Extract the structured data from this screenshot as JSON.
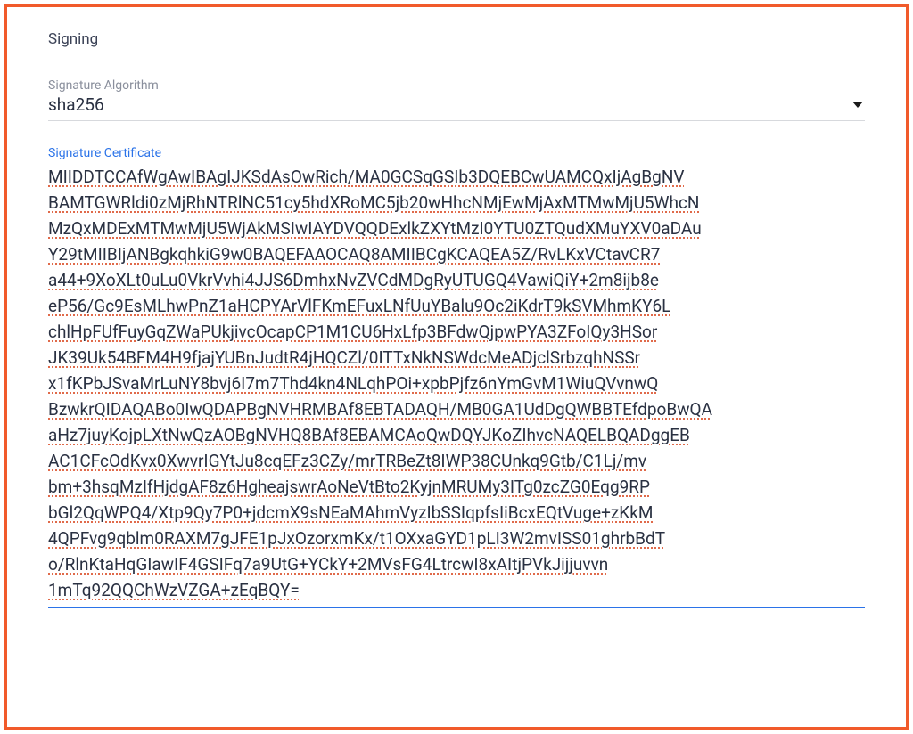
{
  "section": {
    "title": "Signing"
  },
  "signatureAlgorithm": {
    "label": "Signature Algorithm",
    "value": "sha256"
  },
  "signatureCertificate": {
    "label": "Signature Certificate",
    "value": "MIIDDTCCAfWgAwIBAgIJKSdAsOwRich/MA0GCSqGSIb3DQEBCwUAMCQxIjAgBgNV\nBAMTGWRldi0zMjRhNTRlNC51cy5hdXRoMC5jb20wHhcNMjEwMjAxMTMwMjU5WhcN\nMzQxMDExMTMwMjU5WjAkMSIwIAYDVQQDExlkZXYtMzI0YTU0ZTQudXMuYXV0aDAu\nY29tMIIBIjANBgkqhkiG9w0BAQEFAAOCAQ8AMIIBCgKCAQEA5Z/RvLKxVCtavCR7\na44+9XoXLt0uLu0VkrVvhi4JJS6DmhxNvZVCdMDgRyUTUGQ4VawiQiY+2m8ijb8e\neP56/Gc9EsMLhwPnZ1aHCPYArVlFKmEFuxLNfUuYBalu9Oc2iKdrT9kSVMhmKY6L\nchlHpFUfFuyGqZWaPUkjivcOcapCP1M1CU6HxLfp3BFdwQjpwPYA3ZFoIQy3HSor\nJK39Uk54BFM4H9fjajYUBnJudtR4jHQCZl/0ITTxNkNSWdcMeADjclSrbzqhNSSr\nx1fKPbJSvaMrLuNY8bvj6I7m7Thd4kn4NLqhPOi+xpbPjfz6nYmGvM1WiuQVvnwQ\nBzwkrQIDAQABo0IwQDAPBgNVHRMBAf8EBTADAQH/MB0GA1UdDgQWBBTEfdpoBwQA\naHz7juyKojpLXtNwQzAOBgNVHQ8BAf8EBAMCAoQwDQYJKoZIhvcNAQELBQADggEB\nAC1CFcOdKvx0XwvrIGYtJu8cqEFz3CZy/mrTRBeZt8IWP38CUnkq9Gtb/C1Lj/mv\nbm+3hsqMzIfHjdgAF8z6HgheajswrAoNeVtBto2KyjnMRUMy3ITg0zcZG0Eqg9RP\nbGl2QqWPQ4/Xtp9Qy7P0+jdcmX9sNEaMAhmVyzIbSSIqpfsIiBcxEQtVuge+zKkM\n4QPFvg9qblm0RAXM7gJFE1pJxOzorxmKx/t1OXxaGYD1pLI3W2mvISS01ghrbBdT\no/RlnKtaHqGIawIF4GSIFq7a9UtG+YCkY+2MVsFG4LtrcwI8xAItjPVkJijjuvvn\n1mTq92QQChWzVZGA+zEqBQY="
  },
  "colors": {
    "borderAccent": "#f15a2a",
    "labelMuted": "#8a8f9c",
    "labelActive": "#2b73e8",
    "textPrimary": "#2a3142",
    "inputUnderline": "#d7d9dd",
    "activeUnderline": "#2b73e8",
    "spellUnderline": "#e06a4a"
  }
}
